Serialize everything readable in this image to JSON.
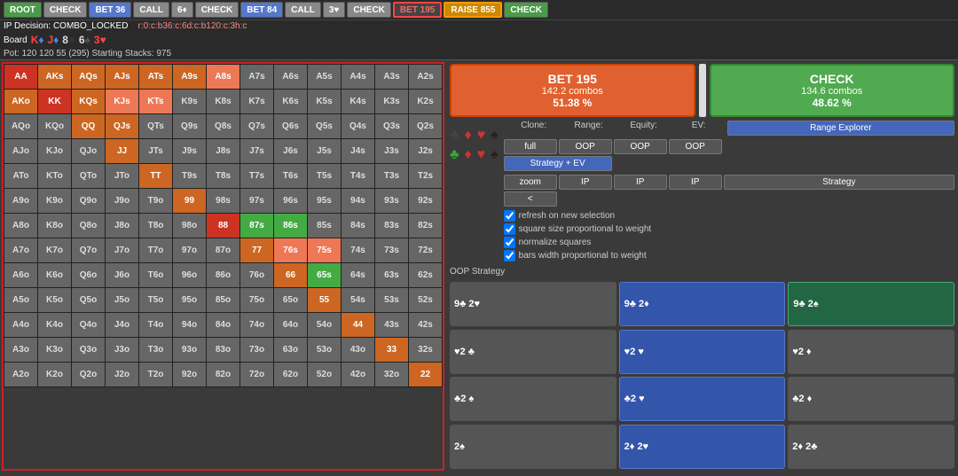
{
  "topbar": {
    "buttons": [
      {
        "label": "ROOT",
        "style": "green"
      },
      {
        "label": "CHECK",
        "style": "gray"
      },
      {
        "label": "BET 36",
        "style": "blue"
      },
      {
        "label": "CALL",
        "style": "gray"
      },
      {
        "label": "6♦",
        "style": "gray"
      },
      {
        "label": "CHECK",
        "style": "gray"
      },
      {
        "label": "BET 84",
        "style": "blue"
      },
      {
        "label": "CALL",
        "style": "gray"
      },
      {
        "label": "3♥",
        "style": "gray"
      },
      {
        "label": "CHECK",
        "style": "gray"
      },
      {
        "label": "BET 195",
        "style": "red-outline"
      },
      {
        "label": "RAISE 855",
        "style": "active-raise"
      },
      {
        "label": "CHECK",
        "style": "green"
      }
    ]
  },
  "infobar": {
    "decision": "IP Decision: COMBO_LOCKED",
    "range": "r:0:c:b36:c:6d:c:b120:c:3h:c"
  },
  "board": {
    "label": "Board",
    "cards": [
      {
        "rank": "K",
        "suit": "♦",
        "color": "red-c"
      },
      {
        "rank": "J",
        "suit": "♦",
        "color": "red-c"
      },
      {
        "rank": "8",
        "suit": "♣",
        "color": "black-c"
      },
      {
        "rank": "6",
        "suit": "♠",
        "color": "black-c"
      },
      {
        "rank": "3",
        "suit": "♥",
        "color": "red-c"
      }
    ]
  },
  "pot": "Pot: 120 120 55 (295)  Starting Stacks: 975",
  "actions": {
    "bet195": {
      "label": "BET 195",
      "combos": "142.2 combos",
      "pct": "51.38 %"
    },
    "check": {
      "label": "CHECK",
      "combos": "134.6 combos",
      "pct": "48.62 %"
    }
  },
  "controls": {
    "clone_label": "Clone:",
    "range_label": "Range:",
    "equity_label": "Equity:",
    "ev_label": "EV:",
    "range_explorer_btn": "Range Explorer",
    "full_btn": "full",
    "zoom_btn": "zoom",
    "oop_btn1": "OOP",
    "oop_btn2": "OOP",
    "oop_btn3": "OOP",
    "ip_btn1": "IP",
    "ip_btn2": "IP",
    "ip_btn3": "IP",
    "strategy_ev_btn": "Strategy + EV",
    "strategy_btn": "Strategy",
    "lt_btn": "<"
  },
  "checkboxes": [
    {
      "id": "cb1",
      "label": "refresh on new selection",
      "checked": true
    },
    {
      "id": "cb2",
      "label": "square size proportional to weight",
      "checked": true
    },
    {
      "id": "cb3",
      "label": "normalize squares",
      "checked": true
    },
    {
      "id": "cb4",
      "label": "bars width proportional to weight",
      "checked": true
    }
  ],
  "oop_strategy_label": "OOP Strategy",
  "matrix": {
    "headers": [
      "AA",
      "AKs",
      "AQs",
      "AJs",
      "ATs",
      "A9s",
      "A8s",
      "A7s",
      "A6s",
      "A5s",
      "A4s",
      "A3s",
      "A2s"
    ],
    "rows": [
      [
        "AA",
        "AKs",
        "AQs",
        "AJs",
        "ATs",
        "A9s",
        "A8s",
        "A7s",
        "A6s",
        "A5s",
        "A4s",
        "A3s",
        "A2s"
      ],
      [
        "AKo",
        "KK",
        "KQs",
        "KJs",
        "KTs",
        "K9s",
        "K8s",
        "K7s",
        "K6s",
        "K5s",
        "K4s",
        "K3s",
        "K2s"
      ],
      [
        "AQo",
        "KQo",
        "QQ",
        "QJs",
        "QTs",
        "Q9s",
        "Q8s",
        "Q7s",
        "Q6s",
        "Q5s",
        "Q4s",
        "Q3s",
        "Q2s"
      ],
      [
        "AJo",
        "KJo",
        "QJo",
        "JJ",
        "JTs",
        "J9s",
        "J8s",
        "J7s",
        "J6s",
        "J5s",
        "J4s",
        "J3s",
        "J2s"
      ],
      [
        "ATo",
        "KTo",
        "QTo",
        "JTo",
        "TT",
        "T9s",
        "T8s",
        "T7s",
        "T6s",
        "T5s",
        "T4s",
        "T3s",
        "T2s"
      ],
      [
        "A9o",
        "K9o",
        "Q9o",
        "J9o",
        "T9o",
        "99",
        "98s",
        "97s",
        "96s",
        "95s",
        "94s",
        "93s",
        "92s"
      ],
      [
        "A8o",
        "K8o",
        "Q8o",
        "J8o",
        "T8o",
        "98o",
        "88",
        "87s",
        "86s",
        "85s",
        "84s",
        "83s",
        "82s"
      ],
      [
        "A7o",
        "K7o",
        "Q7o",
        "J7o",
        "T7o",
        "97o",
        "87o",
        "77",
        "76s",
        "75s",
        "74s",
        "73s",
        "72s"
      ],
      [
        "A6o",
        "K6o",
        "Q6o",
        "J6o",
        "T6o",
        "96o",
        "86o",
        "76o",
        "66",
        "65s",
        "64s",
        "63s",
        "62s"
      ],
      [
        "A5o",
        "K5o",
        "Q5o",
        "J5o",
        "T5o",
        "95o",
        "85o",
        "75o",
        "65o",
        "55",
        "54s",
        "53s",
        "52s"
      ],
      [
        "A4o",
        "K4o",
        "Q4o",
        "J4o",
        "T4o",
        "94o",
        "84o",
        "74o",
        "64o",
        "54o",
        "44",
        "43s",
        "42s"
      ],
      [
        "A3o",
        "K3o",
        "Q3o",
        "J3o",
        "T3o",
        "93o",
        "83o",
        "73o",
        "63o",
        "53o",
        "43o",
        "33",
        "32s"
      ],
      [
        "A2o",
        "K2o",
        "Q2o",
        "J2o",
        "T2o",
        "92o",
        "82o",
        "72o",
        "62o",
        "52o",
        "42o",
        "32o",
        "22"
      ]
    ],
    "colors": [
      [
        "bg-red",
        "bg-orange",
        "bg-orange",
        "bg-orange",
        "bg-orange",
        "bg-orange",
        "bg-salmon",
        "bg-dark-gray",
        "bg-dark-gray",
        "bg-dark-gray",
        "bg-dark-gray",
        "bg-dark-gray",
        "bg-dark-gray"
      ],
      [
        "bg-orange",
        "bg-red",
        "bg-orange",
        "bg-salmon",
        "bg-salmon",
        "bg-dark-gray",
        "bg-dark-gray",
        "bg-dark-gray",
        "bg-dark-gray",
        "bg-dark-gray",
        "bg-dark-gray",
        "bg-dark-gray",
        "bg-dark-gray"
      ],
      [
        "bg-dark-gray",
        "bg-dark-gray",
        "bg-orange",
        "bg-orange",
        "bg-dark-gray",
        "bg-dark-gray",
        "bg-dark-gray",
        "bg-dark-gray",
        "bg-dark-gray",
        "bg-dark-gray",
        "bg-dark-gray",
        "bg-dark-gray",
        "bg-dark-gray"
      ],
      [
        "bg-dark-gray",
        "bg-dark-gray",
        "bg-dark-gray",
        "bg-orange",
        "bg-dark-gray",
        "bg-dark-gray",
        "bg-dark-gray",
        "bg-dark-gray",
        "bg-dark-gray",
        "bg-dark-gray",
        "bg-dark-gray",
        "bg-dark-gray",
        "bg-dark-gray"
      ],
      [
        "bg-dark-gray",
        "bg-dark-gray",
        "bg-dark-gray",
        "bg-dark-gray",
        "bg-orange",
        "bg-dark-gray",
        "bg-dark-gray",
        "bg-dark-gray",
        "bg-dark-gray",
        "bg-dark-gray",
        "bg-dark-gray",
        "bg-dark-gray",
        "bg-dark-gray"
      ],
      [
        "bg-dark-gray",
        "bg-dark-gray",
        "bg-dark-gray",
        "bg-dark-gray",
        "bg-dark-gray",
        "bg-orange",
        "bg-dark-gray",
        "bg-dark-gray",
        "bg-dark-gray",
        "bg-dark-gray",
        "bg-dark-gray",
        "bg-dark-gray",
        "bg-dark-gray"
      ],
      [
        "bg-dark-gray",
        "bg-dark-gray",
        "bg-dark-gray",
        "bg-dark-gray",
        "bg-dark-gray",
        "bg-dark-gray",
        "bg-red",
        "bg-green",
        "bg-green",
        "bg-dark-gray",
        "bg-dark-gray",
        "bg-dark-gray",
        "bg-dark-gray"
      ],
      [
        "bg-dark-gray",
        "bg-dark-gray",
        "bg-dark-gray",
        "bg-dark-gray",
        "bg-dark-gray",
        "bg-dark-gray",
        "bg-dark-gray",
        "bg-orange",
        "bg-salmon",
        "bg-salmon",
        "bg-dark-gray",
        "bg-dark-gray",
        "bg-dark-gray"
      ],
      [
        "bg-dark-gray",
        "bg-dark-gray",
        "bg-dark-gray",
        "bg-dark-gray",
        "bg-dark-gray",
        "bg-dark-gray",
        "bg-dark-gray",
        "bg-dark-gray",
        "bg-orange",
        "bg-green",
        "bg-dark-gray",
        "bg-dark-gray",
        "bg-dark-gray"
      ],
      [
        "bg-dark-gray",
        "bg-dark-gray",
        "bg-dark-gray",
        "bg-dark-gray",
        "bg-dark-gray",
        "bg-dark-gray",
        "bg-dark-gray",
        "bg-dark-gray",
        "bg-dark-gray",
        "bg-orange",
        "bg-dark-gray",
        "bg-dark-gray",
        "bg-dark-gray"
      ],
      [
        "bg-dark-gray",
        "bg-dark-gray",
        "bg-dark-gray",
        "bg-dark-gray",
        "bg-dark-gray",
        "bg-dark-gray",
        "bg-dark-gray",
        "bg-dark-gray",
        "bg-dark-gray",
        "bg-dark-gray",
        "bg-orange",
        "bg-dark-gray",
        "bg-dark-gray"
      ],
      [
        "bg-dark-gray",
        "bg-dark-gray",
        "bg-dark-gray",
        "bg-dark-gray",
        "bg-dark-gray",
        "bg-dark-gray",
        "bg-dark-gray",
        "bg-dark-gray",
        "bg-dark-gray",
        "bg-dark-gray",
        "bg-dark-gray",
        "bg-orange",
        "bg-dark-gray"
      ],
      [
        "bg-dark-gray",
        "bg-dark-gray",
        "bg-dark-gray",
        "bg-dark-gray",
        "bg-dark-gray",
        "bg-dark-gray",
        "bg-dark-gray",
        "bg-dark-gray",
        "bg-dark-gray",
        "bg-dark-gray",
        "bg-dark-gray",
        "bg-dark-gray",
        "bg-orange"
      ]
    ]
  },
  "card_grid": [
    {
      "label": "9♣ 2♥",
      "style": "default"
    },
    {
      "label": "9♣ 2♦",
      "style": "active-blue"
    },
    {
      "label": "9♣ 2♠",
      "style": "active-teal"
    },
    {
      "label": "♥ 2♣",
      "style": "default"
    },
    {
      "label": "♥ 2♥",
      "style": "active-blue"
    },
    {
      "label": "♥ 2♦",
      "style": "default"
    },
    {
      "label": "♣ 2♠",
      "style": "default"
    },
    {
      "label": "♣ 2♥",
      "style": "active-blue"
    },
    {
      "label": "♣ 2♦",
      "style": "default"
    },
    {
      "label": "2♠",
      "style": "default"
    },
    {
      "label": "2♦ 2♥",
      "style": "active-blue"
    },
    {
      "label": "2♦ 2♣",
      "style": "default"
    }
  ]
}
